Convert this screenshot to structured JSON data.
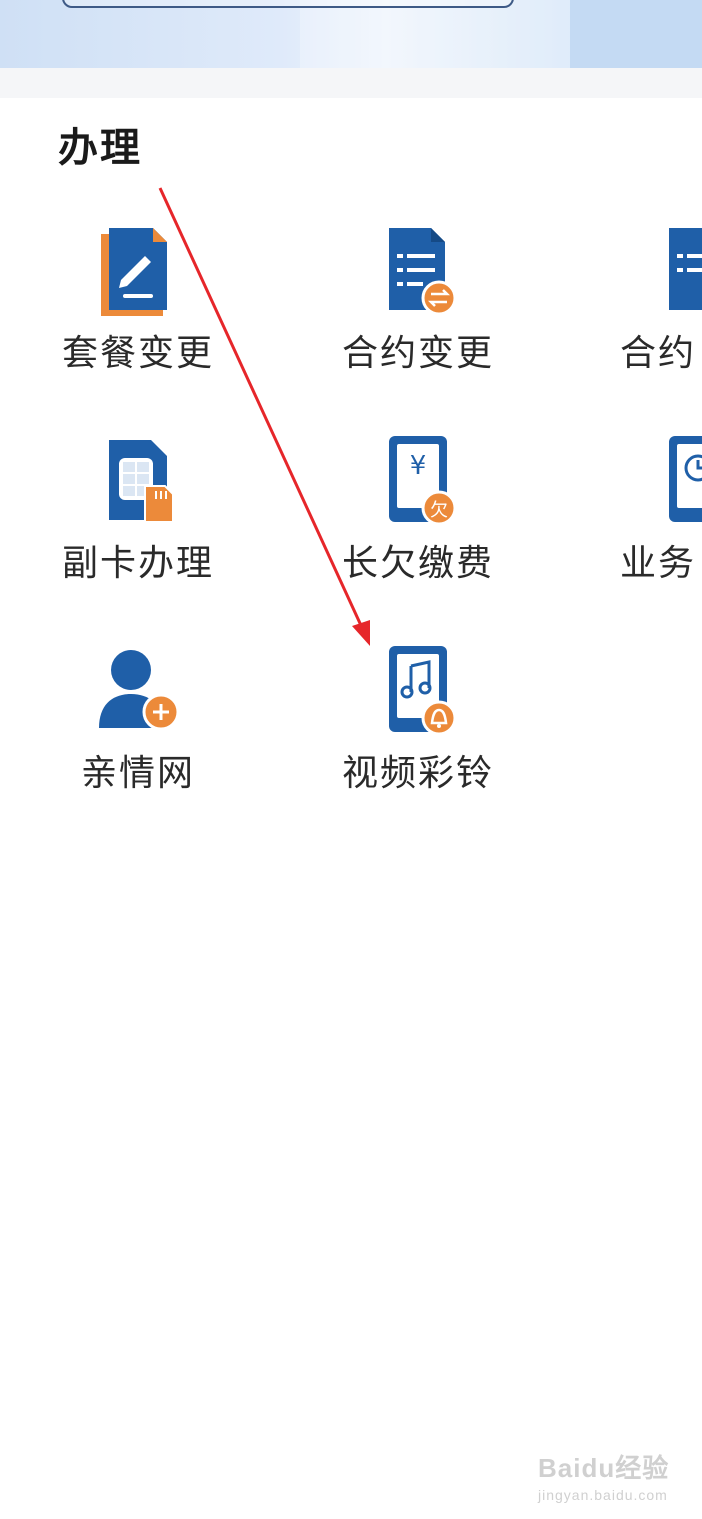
{
  "section": {
    "title": "办理"
  },
  "services": [
    {
      "label": "套餐变更",
      "icon": "document-edit-icon"
    },
    {
      "label": "合约变更",
      "icon": "contract-change-icon"
    },
    {
      "label": "合约",
      "icon": "contract-icon"
    },
    {
      "label": "副卡办理",
      "icon": "sim-card-icon"
    },
    {
      "label": "长欠缴费",
      "icon": "arrears-payment-icon"
    },
    {
      "label": "业务",
      "icon": "business-clock-icon"
    },
    {
      "label": "亲情网",
      "icon": "family-add-user-icon"
    },
    {
      "label": "视频彩铃",
      "icon": "video-ringtone-icon"
    }
  ],
  "watermark": {
    "brand": "Baidu经验",
    "url": "jingyan.baidu.com"
  },
  "colors": {
    "icon_blue": "#1f5fa8",
    "icon_orange": "#ec8a3a",
    "arrow_red": "#e6262a"
  }
}
